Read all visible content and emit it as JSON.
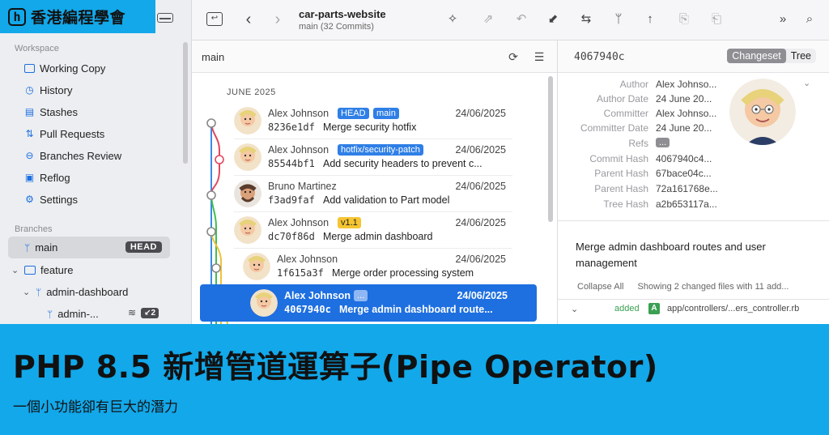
{
  "logo": {
    "mark": "h",
    "text": "香港編程學會"
  },
  "sidebar": {
    "workspace_title": "Workspace",
    "workspace_items": [
      {
        "label": "Working Copy",
        "icon": "folder-icon"
      },
      {
        "label": "History",
        "icon": "history-icon"
      },
      {
        "label": "Stashes",
        "icon": "stash-icon"
      },
      {
        "label": "Pull Requests",
        "icon": "pull-request-icon"
      },
      {
        "label": "Branches Review",
        "icon": "branches-review-icon"
      },
      {
        "label": "Reflog",
        "icon": "reflog-icon"
      },
      {
        "label": "Settings",
        "icon": "gear-icon"
      }
    ],
    "branches_title": "Branches",
    "branches": [
      {
        "label": "main",
        "badge": "HEAD"
      },
      {
        "label": "feature"
      },
      {
        "label": "admin-dashboard"
      },
      {
        "label": "admin-...",
        "count": "2"
      }
    ]
  },
  "toolbar": {
    "repo_name": "car-parts-website",
    "repo_sub": "main (32 Commits)"
  },
  "list": {
    "branch": "main",
    "month": "JUNE 2025",
    "rows": [
      {
        "author": "Alex Johnson",
        "tags": [
          "HEAD",
          "main"
        ],
        "date": "24/06/2025",
        "hash": "8236e1df",
        "msg": "Merge security hotfix"
      },
      {
        "author": "Alex Johnson",
        "tags": [
          "hotfix/security-patch"
        ],
        "date": "24/06/2025",
        "hash": "85544bf1",
        "msg": "Add security headers to prevent c..."
      },
      {
        "author": "Bruno Martinez",
        "tags": [],
        "date": "24/06/2025",
        "hash": "f3ad9faf",
        "msg": "Add validation to Part model"
      },
      {
        "author": "Alex Johnson",
        "tags": [
          "v1.1"
        ],
        "date": "24/06/2025",
        "hash": "dc70f86d",
        "msg": "Merge admin dashboard"
      },
      {
        "author": "Alex Johnson",
        "tags": [],
        "date": "24/06/2025",
        "hash": "1f615a3f",
        "msg": "Merge order processing system"
      },
      {
        "author": "Alex Johnson",
        "tags": [
          "..."
        ],
        "date": "24/06/2025",
        "hash": "4067940c",
        "msg": "Merge admin dashboard route..."
      }
    ]
  },
  "details": {
    "hash": "4067940c",
    "tab_changeset": "Changeset",
    "tab_tree": "Tree",
    "fields": [
      {
        "k": "Author",
        "v": "Alex Johnso..."
      },
      {
        "k": "Author Date",
        "v": "24 June 20..."
      },
      {
        "k": "Committer",
        "v": "Alex Johnso..."
      },
      {
        "k": "Committer Date",
        "v": "24 June 20..."
      },
      {
        "k": "Refs",
        "v": "..."
      },
      {
        "k": "Commit Hash",
        "v": "4067940c4..."
      },
      {
        "k": "Parent Hash",
        "v": "67bace04c..."
      },
      {
        "k": "Parent Hash",
        "v": "72a161768e..."
      },
      {
        "k": "Tree Hash",
        "v": "a2b653117a..."
      }
    ],
    "message": "Merge admin dashboard routes and user management",
    "collapse_all": "Collapse All",
    "showing": "Showing 2 changed files with 11 add...",
    "file_status": "added",
    "file_badge": "A",
    "file_path": "app/controllers/...ers_controller.rb"
  },
  "banner": {
    "title": "PHP 8.5 新增管道運算子(Pipe Operator)",
    "subtitle": "一個小功能卻有巨大的潛力"
  },
  "colors": {
    "accent": "#1e6fe0",
    "banner": "#12a8ea",
    "tag_blue": "#2f7fe6",
    "tag_yellow": "#f5c532"
  }
}
